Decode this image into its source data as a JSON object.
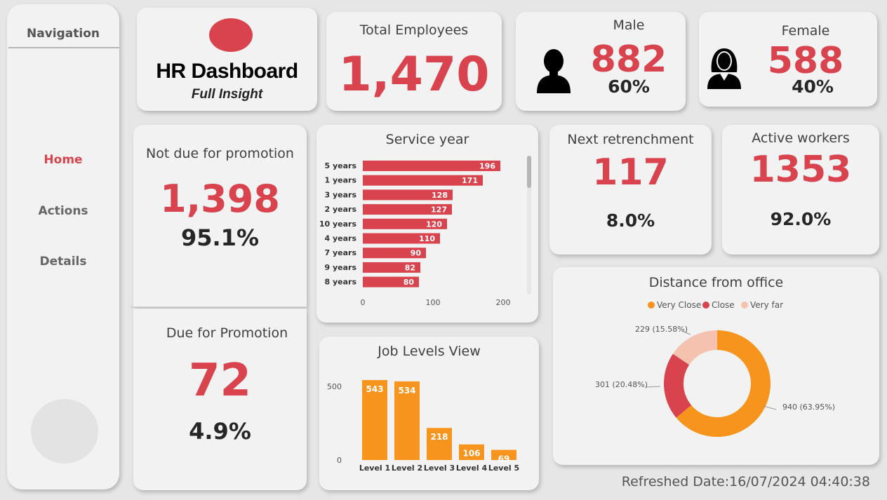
{
  "nav": {
    "heading": "Navigation",
    "items": [
      {
        "label": "Home",
        "active": true
      },
      {
        "label": "Actions",
        "active": false
      },
      {
        "label": "Details",
        "active": false
      }
    ]
  },
  "logo": {
    "title": "HR Dashboard",
    "subtitle": "Full Insight"
  },
  "total": {
    "title": "Total Employees",
    "value": "1,470"
  },
  "male": {
    "title": "Male",
    "value": "882",
    "pct": "60%",
    "icon": "male-person-icon"
  },
  "female": {
    "title": "Female",
    "value": "588",
    "pct": "40%",
    "icon": "female-person-icon"
  },
  "not_due": {
    "title": "Not due for promotion",
    "value": "1,398",
    "pct": "95.1%"
  },
  "due": {
    "title": "Due for Promotion",
    "value": "72",
    "pct": "4.9%"
  },
  "retrenchment": {
    "title": "Next retrenchment",
    "value": "117",
    "pct": "8.0%"
  },
  "active": {
    "title": "Active workers",
    "value": "1353",
    "pct": "92.0%"
  },
  "refreshed": "Refreshed Date:16/07/2024 04:40:38",
  "colors": {
    "accent": "#d9434e",
    "orange": "#f7941d",
    "peach": "#f4c2ae"
  },
  "chart_data": [
    {
      "id": "service",
      "type": "bar",
      "orientation": "horizontal",
      "title": "Service year",
      "categories": [
        "5 years",
        "1 years",
        "3 years",
        "2 years",
        "10 years",
        "4 years",
        "7 years",
        "9 years",
        "8 years"
      ],
      "values": [
        196,
        171,
        128,
        127,
        120,
        110,
        90,
        82,
        80
      ],
      "xticks": [
        0,
        100,
        200
      ],
      "xlim": [
        0,
        220
      ],
      "color": "#d9434e"
    },
    {
      "id": "joblevels",
      "type": "bar",
      "title": "Job Levels View",
      "categories": [
        "Level 1",
        "Level 2",
        "Level 3",
        "Level 4",
        "Level 5"
      ],
      "values": [
        543,
        534,
        218,
        106,
        69
      ],
      "yticks": [
        0,
        500
      ],
      "ylim": [
        0,
        560
      ],
      "color": "#f7941d"
    },
    {
      "id": "distance",
      "type": "pie",
      "donut": true,
      "title": "Distance from office",
      "legend": [
        "Very Close",
        "Close",
        "Very far"
      ],
      "legend_position": "top",
      "slices": [
        {
          "name": "Very Close",
          "value": 940,
          "label": "940 (63.95%)",
          "color": "#f7941d"
        },
        {
          "name": "Close",
          "value": 301,
          "label": "301 (20.48%)",
          "color": "#d9434e"
        },
        {
          "name": "Very far",
          "value": 229,
          "label": "229 (15.58%)",
          "color": "#f4c2ae"
        }
      ]
    }
  ]
}
